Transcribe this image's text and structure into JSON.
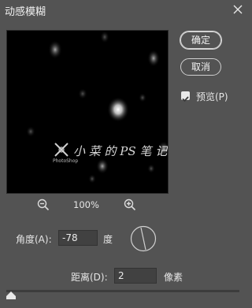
{
  "window": {
    "title": "动感模糊"
  },
  "buttons": {
    "ok_label": "确定",
    "cancel_label": "取消"
  },
  "preview_option": {
    "label": "预览(P)",
    "checked": true
  },
  "zoom": {
    "level": "100%",
    "zoom_out_icon": "zoom-out-icon",
    "zoom_in_icon": "zoom-in-icon"
  },
  "watermark": {
    "text": "小 菜 的 PS 笔 记",
    "sub": "PhotoShop"
  },
  "angle": {
    "label": "角度(A):",
    "value": "-78",
    "unit": "度"
  },
  "distance": {
    "label": "距离(D):",
    "value": "2",
    "unit": "像素",
    "slider_fraction": 0.0
  },
  "colors": {
    "background": "#535353",
    "field": "#414141",
    "text": "#e6e6e6"
  }
}
